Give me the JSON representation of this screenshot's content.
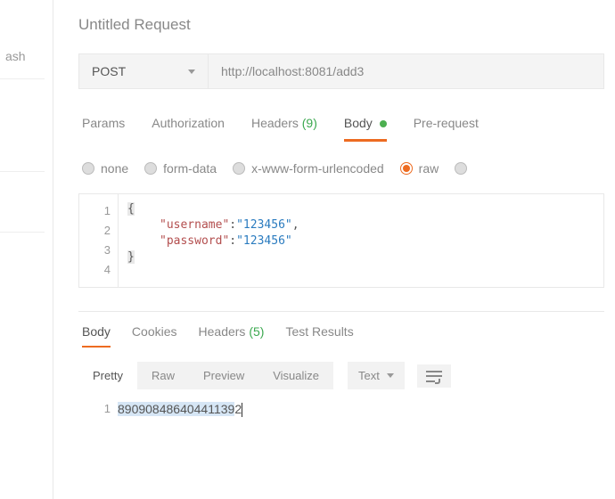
{
  "leftPanel": {
    "label": "ash"
  },
  "title": "Untitled Request",
  "request": {
    "method": "POST",
    "url": "http://localhost:8081/add3"
  },
  "tabs": {
    "params": "Params",
    "authorization": "Authorization",
    "headers": "Headers",
    "headersCount": "(9)",
    "body": "Body",
    "prerequest": "Pre-request"
  },
  "bodyRadios": {
    "none": "none",
    "formData": "form-data",
    "urlEncoded": "x-www-form-urlencoded",
    "raw": "raw"
  },
  "editor": {
    "lines": [
      "1",
      "2",
      "3",
      "4"
    ],
    "openBrace": "{",
    "key1": "\"username\"",
    "val1": "\"123456\"",
    "key2": "\"password\"",
    "val2": "\"123456\"",
    "closeBrace": "}",
    "colon": ":",
    "comma": ","
  },
  "response": {
    "tabs": {
      "body": "Body",
      "cookies": "Cookies",
      "headers": "Headers",
      "headersCount": "(5)",
      "testResults": "Test Results"
    },
    "views": {
      "pretty": "Pretty",
      "raw": "Raw",
      "preview": "Preview",
      "visualize": "Visualize"
    },
    "format": "Text",
    "lineNo": "1",
    "body": "89090848640441139",
    "bodyTail": "2"
  }
}
